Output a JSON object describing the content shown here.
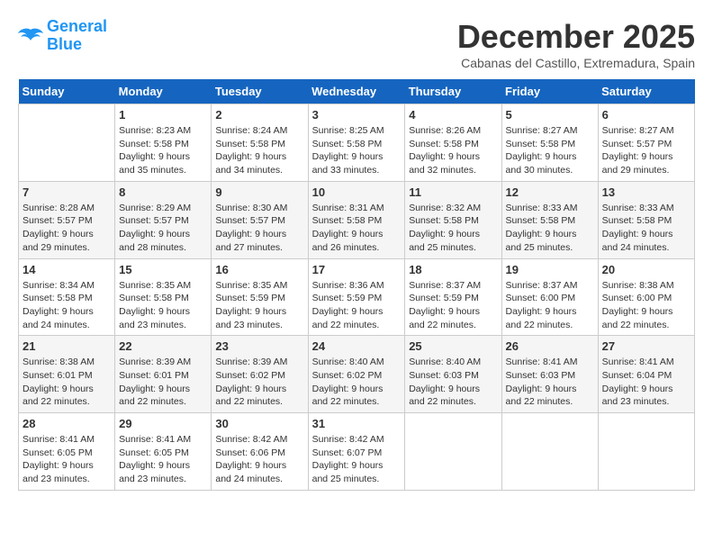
{
  "logo": {
    "line1": "General",
    "line2": "Blue"
  },
  "title": "December 2025",
  "location": "Cabanas del Castillo, Extremadura, Spain",
  "days_header": [
    "Sunday",
    "Monday",
    "Tuesday",
    "Wednesday",
    "Thursday",
    "Friday",
    "Saturday"
  ],
  "weeks": [
    [
      {
        "day": "",
        "sunrise": "",
        "sunset": "",
        "daylight": ""
      },
      {
        "day": "1",
        "sunrise": "Sunrise: 8:23 AM",
        "sunset": "Sunset: 5:58 PM",
        "daylight": "Daylight: 9 hours and 35 minutes."
      },
      {
        "day": "2",
        "sunrise": "Sunrise: 8:24 AM",
        "sunset": "Sunset: 5:58 PM",
        "daylight": "Daylight: 9 hours and 34 minutes."
      },
      {
        "day": "3",
        "sunrise": "Sunrise: 8:25 AM",
        "sunset": "Sunset: 5:58 PM",
        "daylight": "Daylight: 9 hours and 33 minutes."
      },
      {
        "day": "4",
        "sunrise": "Sunrise: 8:26 AM",
        "sunset": "Sunset: 5:58 PM",
        "daylight": "Daylight: 9 hours and 32 minutes."
      },
      {
        "day": "5",
        "sunrise": "Sunrise: 8:27 AM",
        "sunset": "Sunset: 5:58 PM",
        "daylight": "Daylight: 9 hours and 30 minutes."
      },
      {
        "day": "6",
        "sunrise": "Sunrise: 8:27 AM",
        "sunset": "Sunset: 5:57 PM",
        "daylight": "Daylight: 9 hours and 29 minutes."
      }
    ],
    [
      {
        "day": "7",
        "sunrise": "Sunrise: 8:28 AM",
        "sunset": "Sunset: 5:57 PM",
        "daylight": "Daylight: 9 hours and 29 minutes."
      },
      {
        "day": "8",
        "sunrise": "Sunrise: 8:29 AM",
        "sunset": "Sunset: 5:57 PM",
        "daylight": "Daylight: 9 hours and 28 minutes."
      },
      {
        "day": "9",
        "sunrise": "Sunrise: 8:30 AM",
        "sunset": "Sunset: 5:57 PM",
        "daylight": "Daylight: 9 hours and 27 minutes."
      },
      {
        "day": "10",
        "sunrise": "Sunrise: 8:31 AM",
        "sunset": "Sunset: 5:58 PM",
        "daylight": "Daylight: 9 hours and 26 minutes."
      },
      {
        "day": "11",
        "sunrise": "Sunrise: 8:32 AM",
        "sunset": "Sunset: 5:58 PM",
        "daylight": "Daylight: 9 hours and 25 minutes."
      },
      {
        "day": "12",
        "sunrise": "Sunrise: 8:33 AM",
        "sunset": "Sunset: 5:58 PM",
        "daylight": "Daylight: 9 hours and 25 minutes."
      },
      {
        "day": "13",
        "sunrise": "Sunrise: 8:33 AM",
        "sunset": "Sunset: 5:58 PM",
        "daylight": "Daylight: 9 hours and 24 minutes."
      }
    ],
    [
      {
        "day": "14",
        "sunrise": "Sunrise: 8:34 AM",
        "sunset": "Sunset: 5:58 PM",
        "daylight": "Daylight: 9 hours and 24 minutes."
      },
      {
        "day": "15",
        "sunrise": "Sunrise: 8:35 AM",
        "sunset": "Sunset: 5:58 PM",
        "daylight": "Daylight: 9 hours and 23 minutes."
      },
      {
        "day": "16",
        "sunrise": "Sunrise: 8:35 AM",
        "sunset": "Sunset: 5:59 PM",
        "daylight": "Daylight: 9 hours and 23 minutes."
      },
      {
        "day": "17",
        "sunrise": "Sunrise: 8:36 AM",
        "sunset": "Sunset: 5:59 PM",
        "daylight": "Daylight: 9 hours and 22 minutes."
      },
      {
        "day": "18",
        "sunrise": "Sunrise: 8:37 AM",
        "sunset": "Sunset: 5:59 PM",
        "daylight": "Daylight: 9 hours and 22 minutes."
      },
      {
        "day": "19",
        "sunrise": "Sunrise: 8:37 AM",
        "sunset": "Sunset: 6:00 PM",
        "daylight": "Daylight: 9 hours and 22 minutes."
      },
      {
        "day": "20",
        "sunrise": "Sunrise: 8:38 AM",
        "sunset": "Sunset: 6:00 PM",
        "daylight": "Daylight: 9 hours and 22 minutes."
      }
    ],
    [
      {
        "day": "21",
        "sunrise": "Sunrise: 8:38 AM",
        "sunset": "Sunset: 6:01 PM",
        "daylight": "Daylight: 9 hours and 22 minutes."
      },
      {
        "day": "22",
        "sunrise": "Sunrise: 8:39 AM",
        "sunset": "Sunset: 6:01 PM",
        "daylight": "Daylight: 9 hours and 22 minutes."
      },
      {
        "day": "23",
        "sunrise": "Sunrise: 8:39 AM",
        "sunset": "Sunset: 6:02 PM",
        "daylight": "Daylight: 9 hours and 22 minutes."
      },
      {
        "day": "24",
        "sunrise": "Sunrise: 8:40 AM",
        "sunset": "Sunset: 6:02 PM",
        "daylight": "Daylight: 9 hours and 22 minutes."
      },
      {
        "day": "25",
        "sunrise": "Sunrise: 8:40 AM",
        "sunset": "Sunset: 6:03 PM",
        "daylight": "Daylight: 9 hours and 22 minutes."
      },
      {
        "day": "26",
        "sunrise": "Sunrise: 8:41 AM",
        "sunset": "Sunset: 6:03 PM",
        "daylight": "Daylight: 9 hours and 22 minutes."
      },
      {
        "day": "27",
        "sunrise": "Sunrise: 8:41 AM",
        "sunset": "Sunset: 6:04 PM",
        "daylight": "Daylight: 9 hours and 23 minutes."
      }
    ],
    [
      {
        "day": "28",
        "sunrise": "Sunrise: 8:41 AM",
        "sunset": "Sunset: 6:05 PM",
        "daylight": "Daylight: 9 hours and 23 minutes."
      },
      {
        "day": "29",
        "sunrise": "Sunrise: 8:41 AM",
        "sunset": "Sunset: 6:05 PM",
        "daylight": "Daylight: 9 hours and 23 minutes."
      },
      {
        "day": "30",
        "sunrise": "Sunrise: 8:42 AM",
        "sunset": "Sunset: 6:06 PM",
        "daylight": "Daylight: 9 hours and 24 minutes."
      },
      {
        "day": "31",
        "sunrise": "Sunrise: 8:42 AM",
        "sunset": "Sunset: 6:07 PM",
        "daylight": "Daylight: 9 hours and 25 minutes."
      },
      {
        "day": "",
        "sunrise": "",
        "sunset": "",
        "daylight": ""
      },
      {
        "day": "",
        "sunrise": "",
        "sunset": "",
        "daylight": ""
      },
      {
        "day": "",
        "sunrise": "",
        "sunset": "",
        "daylight": ""
      }
    ]
  ]
}
